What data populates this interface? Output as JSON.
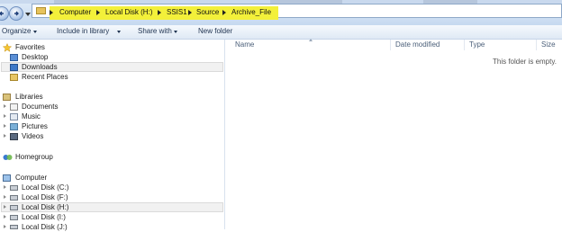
{
  "address_bar": {
    "crumbs": [
      "Computer",
      "Local Disk (H:)",
      "SSIS1",
      "Source",
      "Archive_File"
    ]
  },
  "toolbar": {
    "organize": "Organize",
    "include_in_library": "Include in library",
    "share_with": "Share with",
    "new_folder": "New folder"
  },
  "nav": {
    "favorites": {
      "label": "Favorites",
      "items": [
        "Desktop",
        "Downloads",
        "Recent Places"
      ]
    },
    "libraries": {
      "label": "Libraries",
      "items": [
        "Documents",
        "Music",
        "Pictures",
        "Videos"
      ]
    },
    "homegroup": "Homegroup",
    "computer": {
      "label": "Computer",
      "items": [
        "Local Disk (C:)",
        "Local Disk (F:)",
        "Local Disk (H:)",
        "Local Disk (I:)",
        "Local Disk (J:)"
      ]
    }
  },
  "content": {
    "columns": [
      "Name",
      "Date modified",
      "Type",
      "Size"
    ],
    "empty_message": "This folder is empty."
  },
  "colors": {
    "highlight": "#f3f03a",
    "selection": "#f1f1f1"
  },
  "icons": [
    "back-arrow-icon",
    "forward-arrow-icon",
    "folder-icon",
    "star-icon",
    "desktop-icon",
    "downloads-icon",
    "recent-places-icon",
    "library-icon",
    "documents-icon",
    "music-icon",
    "pictures-icon",
    "videos-icon",
    "homegroup-icon",
    "computer-icon",
    "drive-icon"
  ]
}
